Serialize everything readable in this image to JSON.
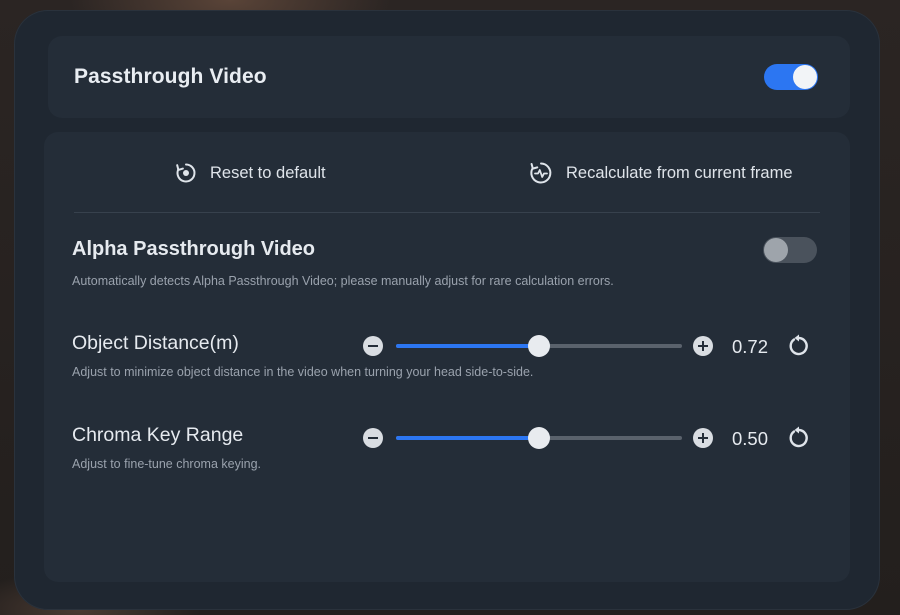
{
  "passthrough": {
    "title": "Passthrough Video",
    "enabled": true
  },
  "actions": {
    "reset_label": "Reset to default",
    "recalculate_label": "Recalculate from current frame"
  },
  "alpha": {
    "title": "Alpha Passthrough Video",
    "description": "Automatically detects Alpha Passthrough Video; please manually adjust for rare calculation errors.",
    "enabled": false
  },
  "sliders": [
    {
      "title": "Object Distance(m)",
      "description": "Adjust to minimize object distance in the video when turning your head side-to-side.",
      "value": "0.72",
      "fraction": 0.5
    },
    {
      "title": "Chroma Key Range",
      "description": "Adjust to fine-tune chroma keying.",
      "value": "0.50",
      "fraction": 0.5
    }
  ],
  "colors": {
    "accent": "#2c76f2",
    "panel": "#1f2731",
    "card": "#242d38"
  },
  "icons": {
    "reset": "reset-target-icon",
    "recalculate": "pulse-refresh-icon",
    "minus": "minus-circle-icon",
    "plus": "plus-circle-icon",
    "slider_reset": "rotate-ccw-icon"
  }
}
